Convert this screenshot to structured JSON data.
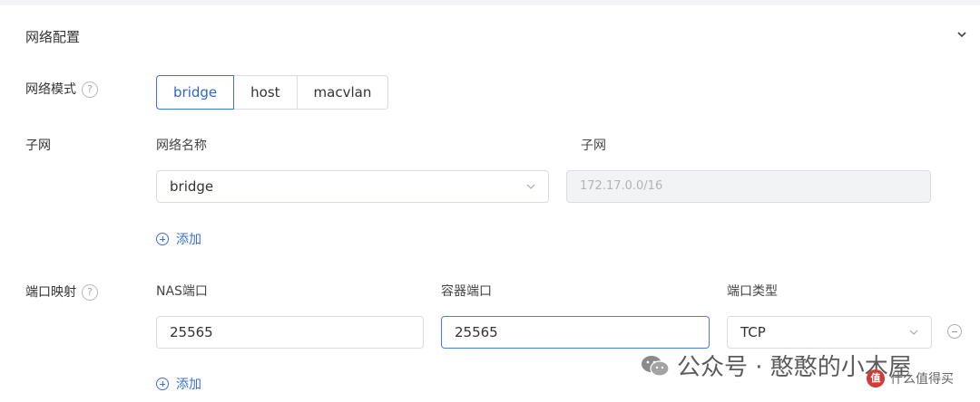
{
  "section": {
    "title": "网络配置"
  },
  "network_mode": {
    "label": "网络模式",
    "help": "?",
    "options": [
      "bridge",
      "host",
      "macvlan"
    ],
    "selected": "bridge"
  },
  "subnet": {
    "label": "子网",
    "name_header": "网络名称",
    "subnet_header": "子网",
    "name_value": "bridge",
    "subnet_value": "172.17.0.0/16",
    "add_label": "添加"
  },
  "ports": {
    "label": "端口映射",
    "help": "?",
    "nas_header": "NAS端口",
    "container_header": "容器端口",
    "type_header": "端口类型",
    "nas_value": "25565",
    "container_value": "25565",
    "type_value": "TCP",
    "add_label": "添加"
  },
  "watermark": {
    "text": "公众号 · 憨憨的小木屋"
  },
  "corner_mark": {
    "badge": "值",
    "text": "什么值得买"
  }
}
